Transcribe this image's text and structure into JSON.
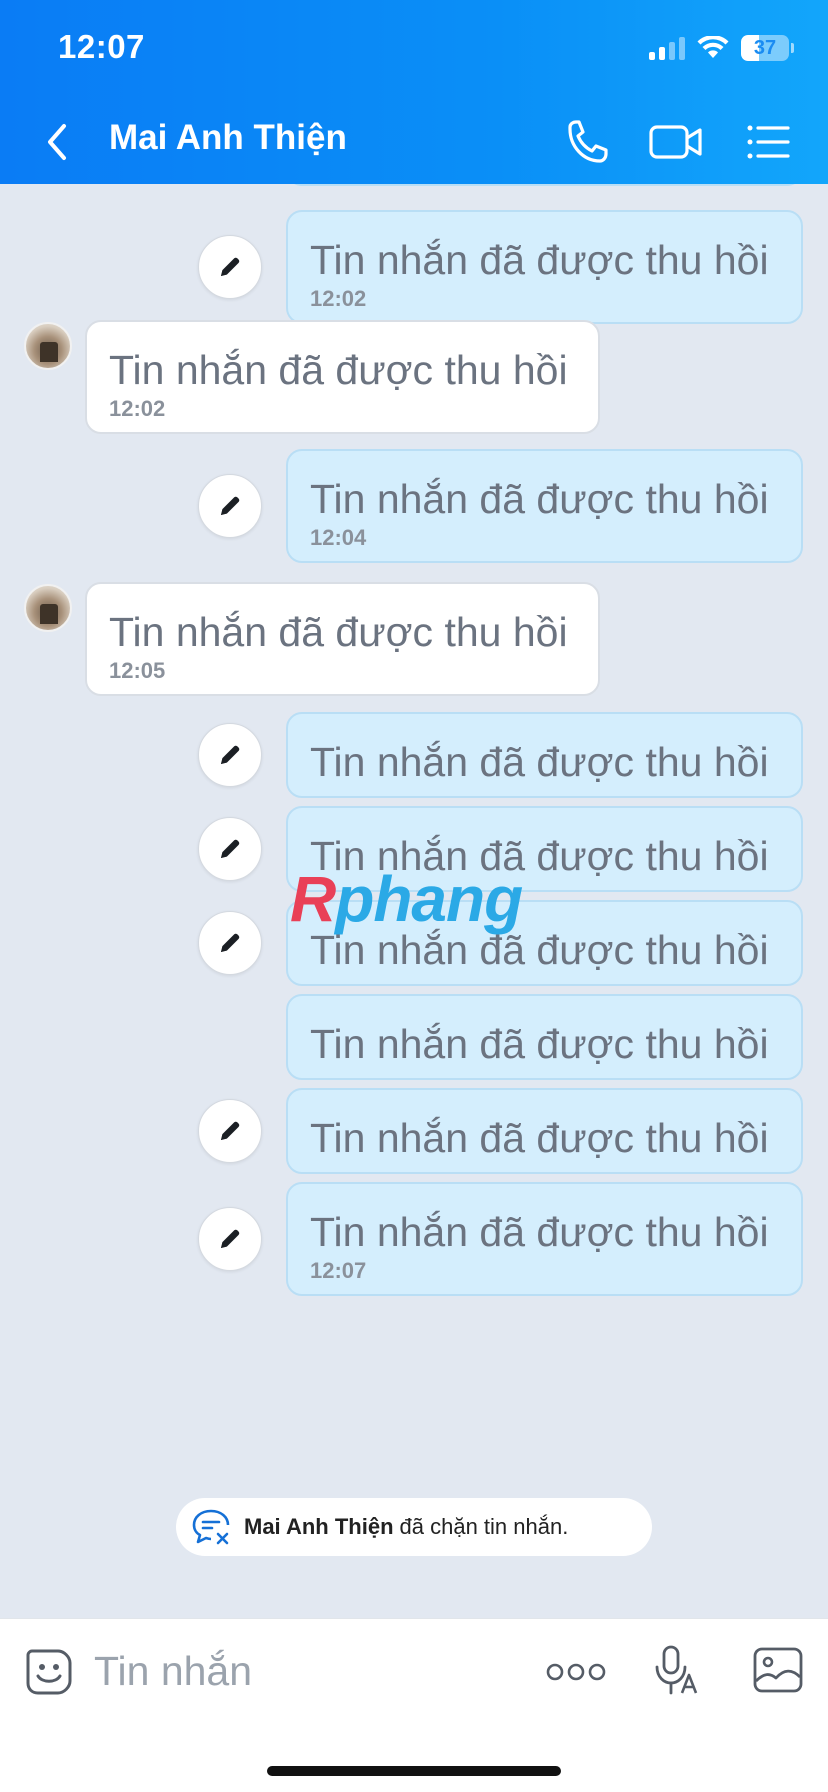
{
  "status_bar": {
    "time": "12:07",
    "battery": "37",
    "battery_level": 0.37
  },
  "nav": {
    "title": "Mai Anh Thiện"
  },
  "messages": [
    {
      "side": "me",
      "text": "Tin nhắn đã được thu hồi",
      "time": "12:02",
      "edit_icon": true
    },
    {
      "side": "them",
      "text": "Tin nhắn đã được thu hồi",
      "time": "12:02"
    },
    {
      "side": "me",
      "text": "Tin nhắn đã được thu hồi",
      "time": "12:04",
      "edit_icon": true
    },
    {
      "side": "them",
      "text": "Tin nhắn đã được thu hồi",
      "time": "12:05"
    },
    {
      "side": "me",
      "text": "Tin nhắn đã được thu hồi",
      "time": "",
      "edit_icon": true
    },
    {
      "side": "me",
      "text": "Tin nhắn đã được thu hồi",
      "time": "",
      "edit_icon": true
    },
    {
      "side": "me",
      "text": "Tin nhắn đã được thu hồi",
      "time": "",
      "edit_icon": true
    },
    {
      "side": "me",
      "text": "Tin nhắn đã được thu hồi",
      "time": "",
      "edit_icon": false
    },
    {
      "side": "me",
      "text": "Tin nhắn đã được thu hồi",
      "time": "",
      "edit_icon": true
    },
    {
      "side": "me",
      "text": "Tin nhắn đã được thu hồi",
      "time": "12:07",
      "edit_icon": true
    }
  ],
  "watermark": {
    "part1": "R",
    "part2": "phang"
  },
  "notice": {
    "name": "Mai Anh Thiện",
    "text": "đã chặn tin nhắn."
  },
  "input": {
    "placeholder": "Tin nhắn",
    "more_label": "ooo"
  }
}
